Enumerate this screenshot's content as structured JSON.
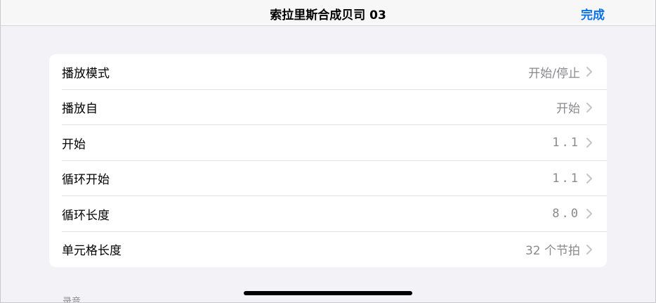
{
  "navbar": {
    "title": "索拉里斯合成贝司 03",
    "done_label": "完成"
  },
  "rows": [
    {
      "label": "播放模式",
      "value": "开始/停止"
    },
    {
      "label": "播放自",
      "value": "开始"
    },
    {
      "label": "开始",
      "value": "1.1"
    },
    {
      "label": "循环开始",
      "value": "1.1"
    },
    {
      "label": "循环长度",
      "value": "8.0"
    },
    {
      "label": "单元格长度",
      "value": "32 个节拍"
    }
  ],
  "section_header": "录音",
  "colors": {
    "accent": "#0a72e8",
    "secondary_text": "#8a8a8e",
    "background": "#f2f2f7"
  },
  "icons": {
    "row_chevron": "chevron-right-icon"
  }
}
